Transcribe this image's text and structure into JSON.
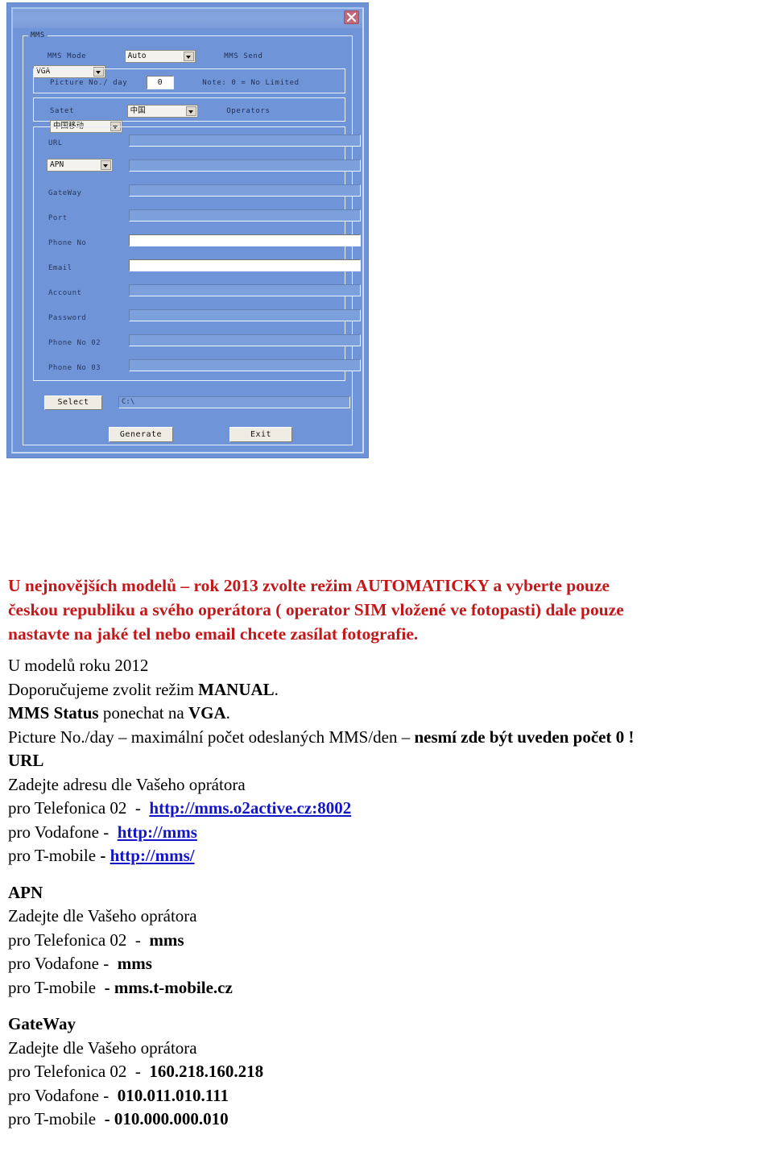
{
  "screenshot": {
    "window_title": "",
    "close_icon": "close-icon",
    "group_label": "MMS",
    "rows": {
      "mms_mode_label": "MMS Mode",
      "mms_mode_value": "Auto",
      "mms_send_label": "MMS Send",
      "mms_send_value": "VGA",
      "picture_no_label": "Picture No./ day",
      "picture_no_value": "0",
      "picture_note": "Note: 0 = No Limited",
      "satet_label": "Satet",
      "satet_value": "中国",
      "operators_label": "Operators",
      "operators_value": "中国移动"
    },
    "fields": [
      {
        "label": "URL",
        "value": "",
        "type": "label",
        "enabled": false
      },
      {
        "label": "APN",
        "value": "",
        "type": "combo",
        "enabled": false
      },
      {
        "label": "GateWay",
        "value": "",
        "type": "label",
        "enabled": false
      },
      {
        "label": "Port",
        "value": "",
        "type": "label",
        "enabled": false
      },
      {
        "label": "Phone No",
        "value": "",
        "type": "label",
        "enabled": true
      },
      {
        "label": "Email",
        "value": "",
        "type": "label",
        "enabled": true
      },
      {
        "label": "Account",
        "value": "",
        "type": "label",
        "enabled": false
      },
      {
        "label": "Password",
        "value": "",
        "type": "label",
        "enabled": false
      },
      {
        "label": "Phone No 02",
        "value": "",
        "type": "label",
        "enabled": false
      },
      {
        "label": "Phone No 03",
        "value": "",
        "type": "label",
        "enabled": false
      }
    ],
    "path_row": {
      "select_label": "Select",
      "path_value": "C:\\"
    },
    "buttons": {
      "generate_label": "Generate",
      "exit_label": "Exit"
    },
    "colors": {
      "dialog_bg": "#6f95d8",
      "close_btn": "#c0697a",
      "button_face": "#efece3"
    }
  },
  "doc": {
    "intro_red": {
      "line1": "U nejnovějších modelů – rok 2013 zvolte režim AUTOMATICKY a vyberte pouze",
      "line2": "českou republiku a svého operátora ( operator SIM vložené ve fotopasti) dale pouze",
      "line3": "nastavte na jaké tel nebo email chcete zasílat fotografie."
    },
    "models2012": {
      "line1": "U modelů roku 2012",
      "line2_pre": "Doporučujeme zvolit režim ",
      "line2_bold": "MANUAL",
      "line2_post": ".",
      "line3_bold": "MMS Status",
      "line3_mid": " ponechat na ",
      "line3_bold2": "VGA",
      "line3_post": ".",
      "line4_pre": "Picture No./day – maximální počet odeslaných MMS/den – ",
      "line4_bold": "nesmí zde být uveden počet 0 !"
    },
    "url_section": {
      "heading": "URL",
      "subtitle": "Zadejte adresu dle Vašeho oprátora",
      "rows": [
        {
          "operator": "pro Telefonica 02",
          "dash": "-",
          "value": "http://mms.o2active.cz:8002",
          "link": true
        },
        {
          "operator": "pro Vodafone",
          "dash": "-",
          "value": "http://mms",
          "link": true
        },
        {
          "operator": "pro T-mobile",
          "dash": "-",
          "value": "http://mms/",
          "link": true
        }
      ]
    },
    "apn_section": {
      "heading": "APN",
      "subtitle": "Zadejte dle Vašeho oprátora",
      "rows": [
        {
          "operator": "pro Telefonica 02",
          "dash": "-",
          "value": "mms",
          "link": false
        },
        {
          "operator": "pro Vodafone",
          "dash": "-",
          "value": "mms",
          "link": false
        },
        {
          "operator": "pro T-mobile",
          "dash": "-",
          "value": "mms.t-mobile.cz",
          "link": false
        }
      ]
    },
    "gateway_section": {
      "heading": "GateWay",
      "subtitle": "Zadejte dle Vašeho oprátora",
      "rows": [
        {
          "operator": "pro Telefonica 02",
          "dash": "-",
          "value": "160.218.160.218",
          "link": false
        },
        {
          "operator": "pro Vodafone",
          "dash": "-",
          "value": "010.011.010.111",
          "link": false
        },
        {
          "operator": "pro T-mobile",
          "dash": "-",
          "value": "010.000.000.010",
          "link": false
        }
      ]
    }
  }
}
